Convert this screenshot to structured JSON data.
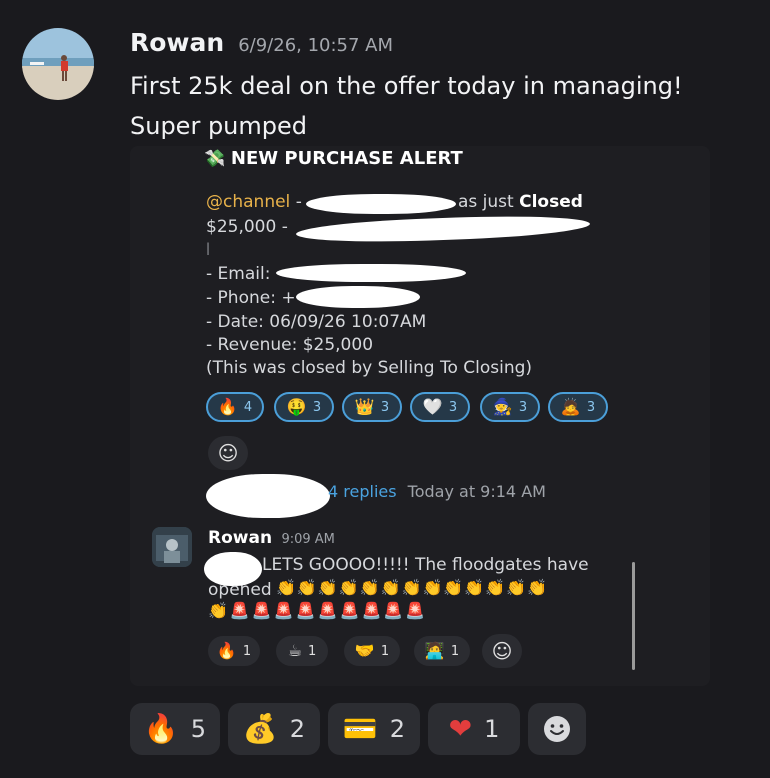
{
  "message": {
    "author": "Rowan",
    "timestamp": "6/9/26, 10:57 AM",
    "text": "First 25k deal on the offer today in managing! Super pumped"
  },
  "embed": {
    "title": "NEW PURCHASE ALERT",
    "title_icon": "money-wings",
    "channel_mention": "@channel",
    "dash": "-",
    "closed_prefix": "as just",
    "closed_word": "Closed",
    "amount": "$25,000 -",
    "email_label": "- Email:",
    "phone_label": "- Phone: +",
    "date_line": "- Date: 06/09/26 10:07AM",
    "revenue_line": "- Revenue: $25,000",
    "closed_by_line": "(This was closed by Selling To Closing)",
    "reactions": [
      {
        "icon": "fire",
        "glyph": "🔥",
        "count": "4"
      },
      {
        "icon": "money-mouth-face",
        "glyph": "🤑",
        "count": "3"
      },
      {
        "icon": "crown",
        "glyph": "👑",
        "count": "3"
      },
      {
        "icon": "white-heart",
        "glyph": "🤍",
        "count": "3"
      },
      {
        "icon": "mage",
        "glyph": "🧙",
        "count": "3"
      },
      {
        "icon": "bowing-person",
        "glyph": "🙇",
        "count": "3"
      }
    ],
    "add_reaction_glyph": "☺",
    "replies": "4 replies",
    "replies_time": "Today at 9:14 AM",
    "reply": {
      "author": "Rowan",
      "time": "9:09 AM",
      "text_line1": "LETS GOOOO!!!!! The floodgates have",
      "text_line2": "opened",
      "clap_row1": "👏👏👏👏👏👏👏👏👏👏👏👏👏",
      "clap_row2": "👏🚨🚨🚨🚨🚨🚨🚨🚨🚨",
      "reactions": [
        {
          "icon": "fire",
          "glyph": "🔥",
          "count": "1"
        },
        {
          "icon": "hot-beverage",
          "glyph": "☕",
          "count": "1"
        },
        {
          "icon": "handshake",
          "glyph": "🤝",
          "count": "1"
        },
        {
          "icon": "person-at-laptop",
          "glyph": "🧑‍💻",
          "count": "1"
        }
      ]
    }
  },
  "reactions": [
    {
      "icon": "fire",
      "glyph": "🔥",
      "count": "5"
    },
    {
      "icon": "money-bag",
      "glyph": "💰",
      "count": "2"
    },
    {
      "icon": "credit-card",
      "glyph": "💳",
      "count": "2"
    },
    {
      "icon": "red-heart",
      "glyph": "❤",
      "count": "1"
    }
  ],
  "add_reaction_icon": "smiley-add-icon",
  "colors": {
    "background": "#1a1a1e",
    "embed_bg": "#1e1e22",
    "mention": "#e8b24a",
    "link": "#4aa3e0",
    "selected_chip_border": "#4b9fd9"
  }
}
